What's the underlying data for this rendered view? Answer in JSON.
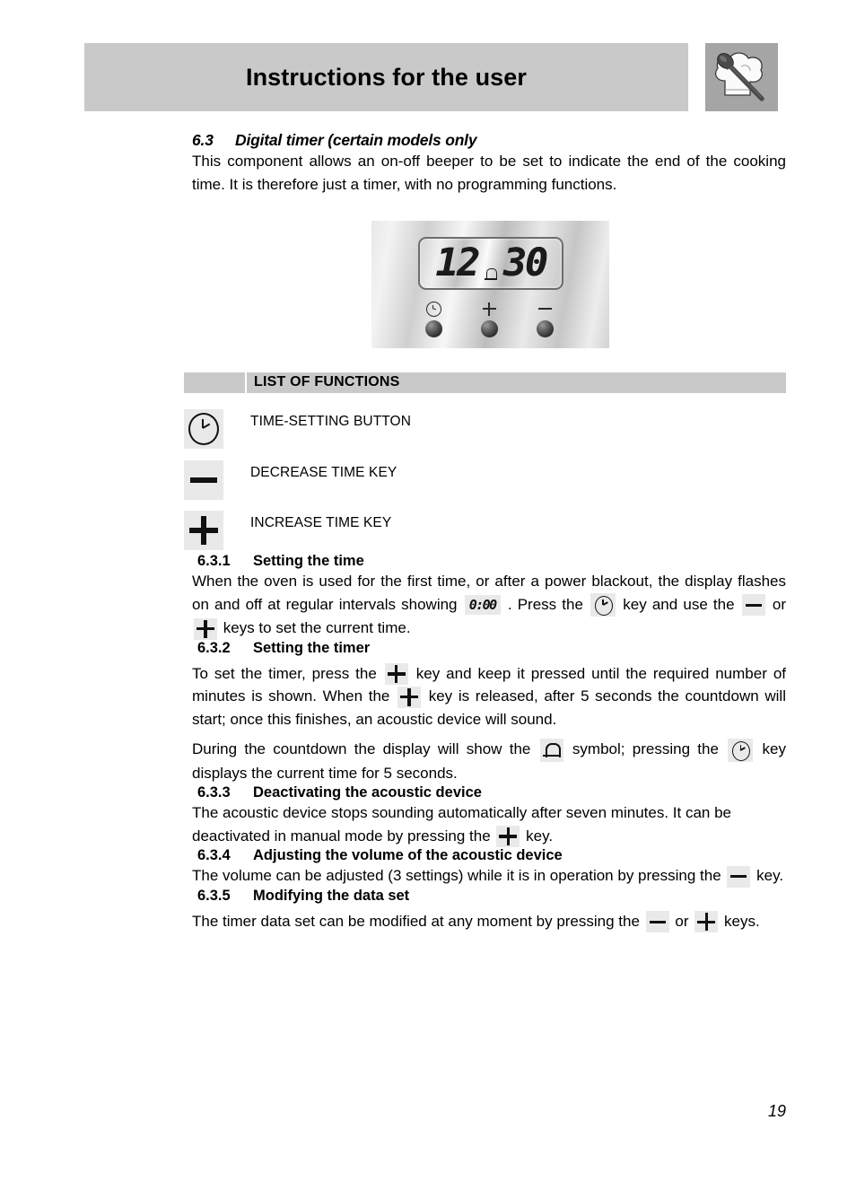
{
  "header": {
    "title": "Instructions for the user",
    "logo_icon": "chef-hat-spoon-icon"
  },
  "section": {
    "number": "6.3",
    "title": "Digital timer (certain models only",
    "intro": "This component allows an on-off beeper to be set to indicate the end of the cooking time. It is therefore just a timer, with no programming functions."
  },
  "panel": {
    "display_hours": "12",
    "display_minutes": "30",
    "bell_icon": "bell-icon",
    "buttons": [
      {
        "icon": "clock-icon",
        "name": "time-setting-button"
      },
      {
        "icon": "plus-icon",
        "name": "increase-time-button"
      },
      {
        "icon": "minus-icon",
        "name": "decrease-time-button"
      }
    ]
  },
  "functions": {
    "heading": "LIST OF FUNCTIONS",
    "items": [
      {
        "icon": "clock-icon",
        "label": "TIME-SETTING BUTTON"
      },
      {
        "icon": "minus-icon",
        "label": "DECREASE TIME KEY"
      },
      {
        "icon": "plus-icon",
        "label": "INCREASE TIME KEY"
      }
    ]
  },
  "subsections": {
    "s1": {
      "number": "6.3.1",
      "title": "Setting the time",
      "t1": "When the oven is used for the first time, or after a power blackout, the display flashes on and off at regular intervals showing",
      "lcd_value": "0:00",
      "t2": ". Press the",
      "t3": "key and use the",
      "t4": "or",
      "t5": "keys to set the current time."
    },
    "s2": {
      "number": "6.3.2",
      "title": "Setting the timer",
      "t1": "To set the timer, press the",
      "t2": "key and keep it pressed until the required number of minutes is shown.  When the",
      "t3": "key is released, after 5 seconds the countdown will start; once this finishes, an acoustic device will sound.",
      "t4": "During the countdown the display will show the",
      "t5": "symbol; pressing the",
      "t6": "key displays the current time for 5 seconds."
    },
    "s3": {
      "number": "6.3.3",
      "title": "Deactivating the acoustic device",
      "t1": "The acoustic device stops sounding automatically after seven minutes.  It can be deactivated in manual mode by pressing the",
      "t2": "key."
    },
    "s4": {
      "number": "6.3.4",
      "title": "Adjusting the volume of the acoustic device",
      "t1": "The volume can be adjusted (3 settings) while it is in operation by pressing the",
      "t2": "key."
    },
    "s5": {
      "number": "6.3.5",
      "title": "Modifying the data set",
      "t1": "The timer data set can be modified at any moment by pressing the",
      "t2": "or",
      "t3": "keys."
    }
  },
  "footer": {
    "page_number": "19"
  },
  "colors": {
    "banner_gray": "#c9c9c9",
    "logo_gray": "#a5a5a5",
    "key_box_gray": "#e9e9e9"
  }
}
